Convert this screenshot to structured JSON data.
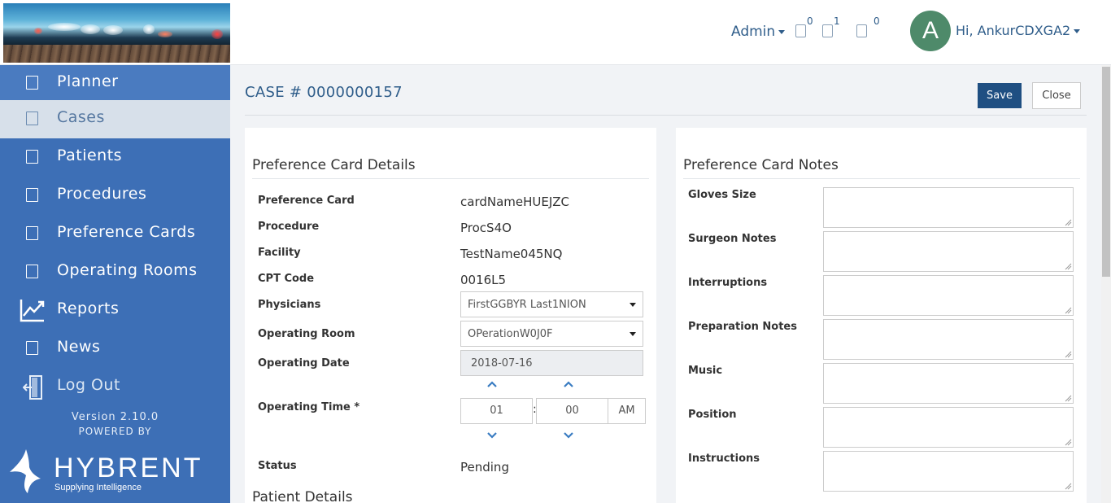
{
  "header": {
    "admin_label": "Admin",
    "badge_counts": [
      "0",
      "1",
      "0"
    ],
    "avatar_letter": "A",
    "greeting": "Hi, AnkurCDXGA2"
  },
  "sidebar": {
    "items": [
      {
        "label": "Planner",
        "icon": "square-icon"
      },
      {
        "label": "Cases",
        "icon": "square-icon"
      },
      {
        "label": "Patients",
        "icon": "square-icon"
      },
      {
        "label": "Procedures",
        "icon": "square-icon"
      },
      {
        "label": "Preference Cards",
        "icon": "square-icon"
      },
      {
        "label": "Operating Rooms",
        "icon": "square-icon"
      },
      {
        "label": "Reports",
        "icon": "chart-trend-icon"
      },
      {
        "label": "News",
        "icon": "square-icon"
      },
      {
        "label": "Log Out",
        "icon": "logout-door-icon"
      }
    ],
    "version": "Version 2.10.0",
    "powered_by": "POWERED BY",
    "brand": "HYBRENT",
    "tagline": "Supplying Intelligence"
  },
  "main": {
    "case_title": "CASE # 0000000157",
    "save_label": "Save",
    "close_label": "Close"
  },
  "details": {
    "heading": "Preference Card Details",
    "rows": [
      {
        "label": "Preference Card",
        "value": "cardNameHUEJZC"
      },
      {
        "label": "Procedure",
        "value": "ProcS4O"
      },
      {
        "label": "Facility",
        "value": "TestName045NQ"
      },
      {
        "label": "CPT Code",
        "value": "0016L5"
      }
    ],
    "physicians_label": "Physicians",
    "physicians_value": "FirstGGBYR Last1NION",
    "operating_room_label": "Operating Room",
    "operating_room_value": "OPerationW0J0F",
    "operating_date_label": "Operating Date",
    "operating_date_value": "2018-07-16",
    "operating_time_label": "Operating Time *",
    "hour": "01",
    "minute": "00",
    "colon": ":",
    "meridian": "AM",
    "status_label": "Status",
    "status_value": "Pending",
    "patient_heading": "Patient Details"
  },
  "notes": {
    "heading": "Preference Card Notes",
    "fields": [
      {
        "label": "Gloves Size"
      },
      {
        "label": "Surgeon Notes"
      },
      {
        "label": "Interruptions"
      },
      {
        "label": "Preparation Notes"
      },
      {
        "label": "Music"
      },
      {
        "label": "Position"
      },
      {
        "label": "Instructions"
      }
    ]
  },
  "colors": {
    "sidebar": "#3d6fb6",
    "primary_button": "#1f4f82",
    "link_text": "#2f5d8a",
    "active_nav": "#d7e0ea",
    "avatar": "#4e8a6a"
  }
}
